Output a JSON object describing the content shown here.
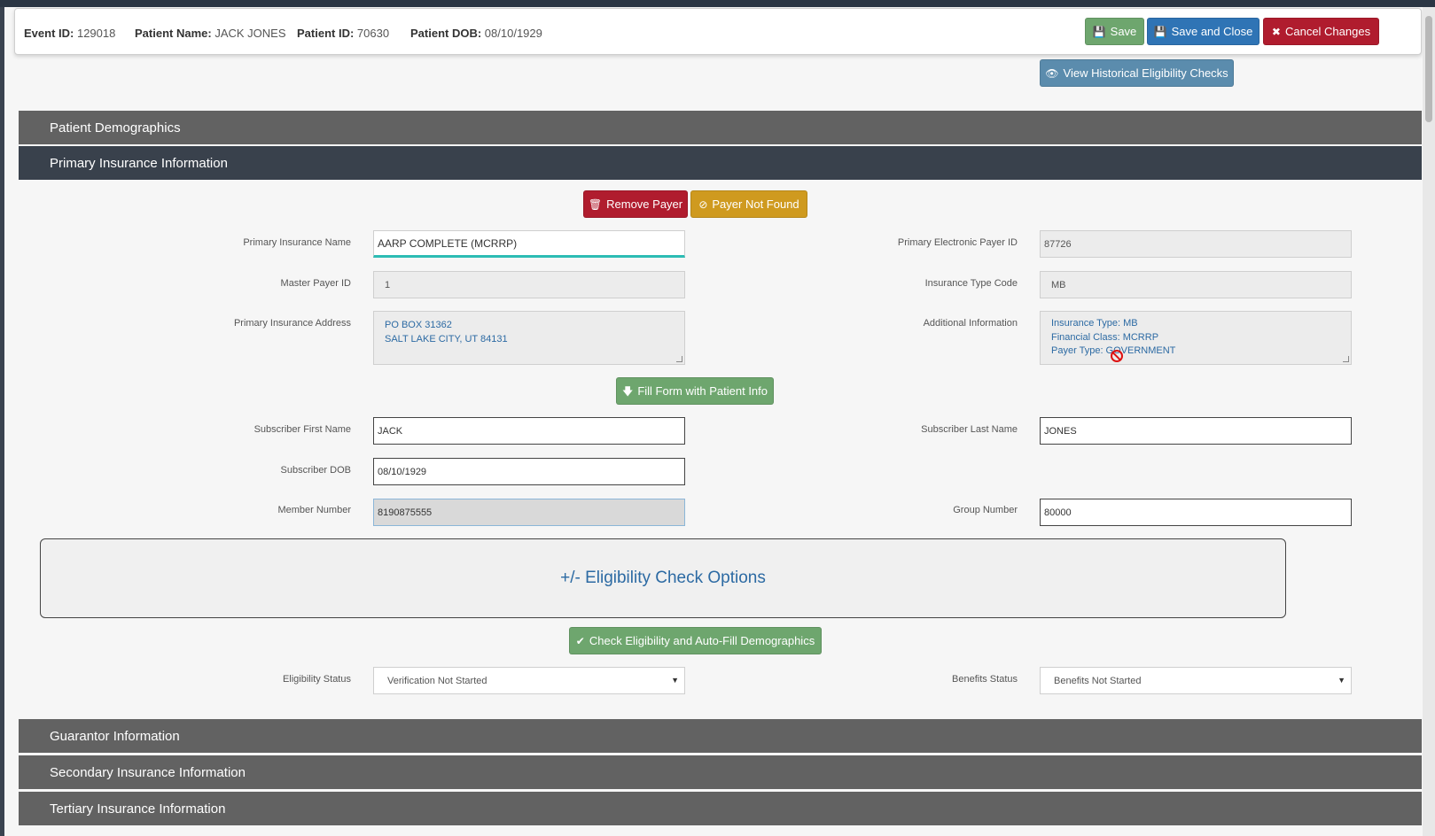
{
  "header": {
    "event_id_label": "Event ID:",
    "event_id": "129018",
    "patient_name_label": "Patient Name:",
    "patient_name": "JACK JONES",
    "patient_id_label": "Patient ID:",
    "patient_id": "70630",
    "patient_dob_label": "Patient DOB:",
    "patient_dob": "08/10/1929",
    "save_label": "Save",
    "save_close_label": "Save and Close",
    "cancel_label": "Cancel Changes"
  },
  "view_historical_label": "View Historical Eligibility Checks",
  "sections": {
    "demographics": "Patient Demographics",
    "primary": "Primary Insurance Information",
    "guarantor": "Guarantor Information",
    "secondary": "Secondary Insurance Information",
    "tertiary": "Tertiary Insurance Information"
  },
  "primary": {
    "remove_payer_label": "Remove Payer",
    "payer_not_found_label": "Payer Not Found",
    "insurance_name_label": "Primary Insurance Name",
    "insurance_name": "AARP COMPLETE (MCRRP)",
    "electronic_payer_id_label": "Primary Electronic Payer ID",
    "electronic_payer_id": "87726",
    "master_payer_id_label": "Master Payer ID",
    "master_payer_id": "1",
    "insurance_type_code_label": "Insurance Type Code",
    "insurance_type_code": "MB",
    "address_label": "Primary Insurance Address",
    "address_line1": "PO BOX 31362",
    "address_line2": "SALT LAKE CITY, UT 84131",
    "additional_info_label": "Additional Information",
    "additional_line1": "Insurance Type: MB",
    "additional_line2": "Financial Class: MCRRP",
    "additional_line3": "Payer Type: GOVERNMENT",
    "fill_form_label": "Fill Form with Patient Info",
    "subscriber_first_label": "Subscriber First Name",
    "subscriber_first": "JACK",
    "subscriber_last_label": "Subscriber Last Name",
    "subscriber_last": "JONES",
    "subscriber_dob_label": "Subscriber DOB",
    "subscriber_dob": "08/10/1929",
    "member_number_label": "Member Number",
    "member_number": "8190875555",
    "group_number_label": "Group Number",
    "group_number": "80000",
    "eligibility_options_label": "+/- Eligibility Check Options",
    "check_eligibility_label": "Check Eligibility and Auto-Fill Demographics",
    "eligibility_status_label": "Eligibility Status",
    "eligibility_status": "Verification Not Started",
    "benefits_status_label": "Benefits Status",
    "benefits_status": "Benefits Not Started"
  },
  "colors": {
    "save": "#6ea66e",
    "save_close": "#2f74b5",
    "cancel": "#b01c2e",
    "section_active": "#39414c",
    "section": "#626262",
    "focus_underline": "#2cbcb4"
  },
  "icons": {
    "save": "floppy-disk-icon",
    "cancel": "x-icon",
    "view": "eye-icon",
    "remove": "trash-icon",
    "not_found": "ban-icon",
    "fill": "arrow-down-icon",
    "check": "check-icon"
  }
}
